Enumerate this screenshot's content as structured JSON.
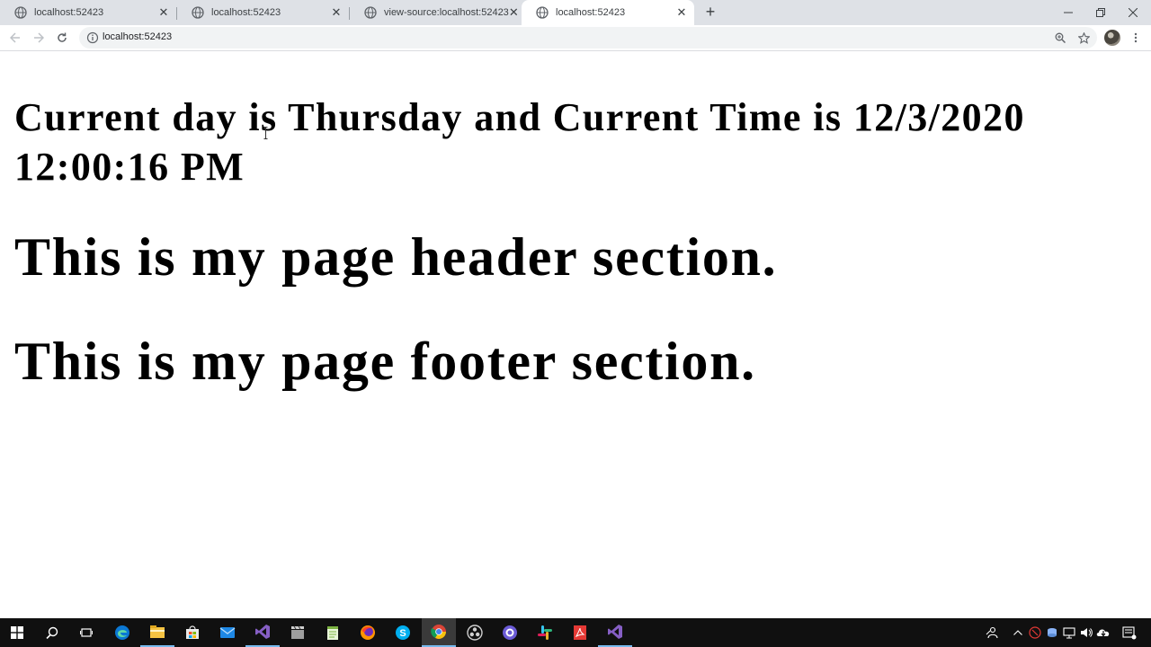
{
  "browser": {
    "tabs": [
      {
        "title": "localhost:52423",
        "active": false
      },
      {
        "title": "localhost:52423",
        "active": false
      },
      {
        "title": "view-source:localhost:52423",
        "active": false
      },
      {
        "title": "localhost:52423",
        "active": true
      }
    ],
    "address_url": "localhost:52423"
  },
  "page": {
    "datetime_heading": "Current day is Thursday and Current Time is 12/3/2020 12:00:16 PM",
    "header_text": "This is my page header section.",
    "footer_text": "This is my page footer section."
  },
  "taskbar": {
    "apps": [
      "start-icon",
      "search-icon",
      "task-view-icon",
      "edge-icon",
      "file-explorer-icon",
      "store-icon",
      "mail-icon",
      "visual-studio-icon",
      "media-app-icon",
      "notepad-plus-icon",
      "firefox-icon",
      "skype-icon",
      "chrome-icon",
      "obs-icon",
      "teams-icon",
      "slack-icon",
      "acrobat-icon",
      "visual-studio-2-icon"
    ],
    "tray": [
      "people-icon",
      "chevron-up-icon",
      "security-icon",
      "network-app-icon",
      "monitor-icon",
      "volume-icon",
      "onedrive-icon",
      "notification-icon"
    ]
  },
  "colors": {
    "tabstrip": "#dee1e6",
    "taskbar": "#101010",
    "accent": "#76b9ed"
  }
}
